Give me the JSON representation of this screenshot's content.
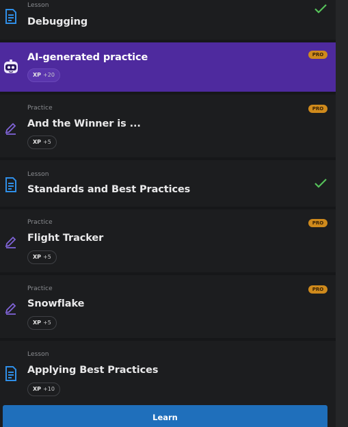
{
  "items": [
    {
      "kind": "Lesson",
      "title": "Debugging",
      "completed": true,
      "icon": "lesson-doc-icon"
    },
    {
      "kind": "",
      "title": "AI-generated practice",
      "xp_label": "XP",
      "xp_value": "+20",
      "pro": "PRO",
      "active": true,
      "icon": "ai-bot-icon"
    },
    {
      "kind": "Practice",
      "title": "And the Winner is ...",
      "xp_label": "XP",
      "xp_value": "+5",
      "pro": "PRO",
      "icon": "practice-pencil-icon"
    },
    {
      "kind": "Lesson",
      "title": "Standards and Best Practices",
      "completed": true,
      "icon": "lesson-doc-icon"
    },
    {
      "kind": "Practice",
      "title": "Flight Tracker",
      "xp_label": "XP",
      "xp_value": "+5",
      "pro": "PRO",
      "icon": "practice-pencil-icon"
    },
    {
      "kind": "Practice",
      "title": "Snowflake",
      "xp_label": "XP",
      "xp_value": "+5",
      "pro": "PRO",
      "icon": "practice-pencil-icon"
    },
    {
      "kind": "Lesson",
      "title": "Applying Best Practices",
      "xp_label": "XP",
      "xp_value": "+10",
      "icon": "lesson-doc-icon"
    }
  ],
  "learn_button": {
    "label": "Learn"
  },
  "colors": {
    "accent_purple": "#4e2a9e",
    "lesson_icon_blue": "#2f8fe8",
    "practice_icon_purple": "#7f63d6",
    "check_green": "#56c25a",
    "pro_badge": "#cf8a1c",
    "learn_button": "#1f6fbb"
  }
}
